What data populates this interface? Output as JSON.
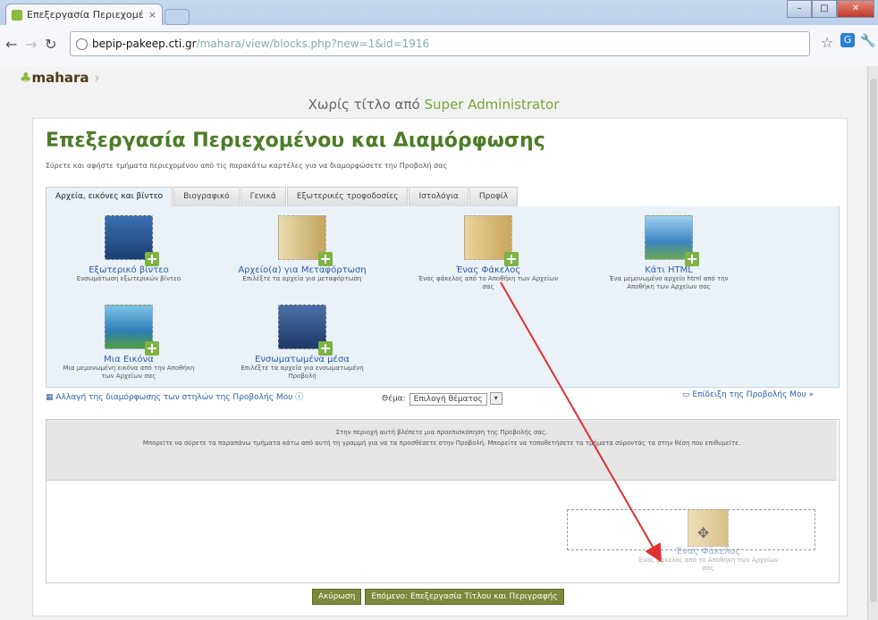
{
  "browser": {
    "tab_title": "Επεξεργασία Περιεχομέν",
    "tab_close": "×",
    "url_host": "bepip-pakeep.cti.gr",
    "url_path": "/mahara/view/blocks.php?new=1&id=1916",
    "window_controls": [
      "–",
      "□",
      "✕"
    ]
  },
  "site": {
    "logo": "mahara",
    "page_title_prefix": "Χωρίς τίτλο από",
    "page_title_user": "Super Administrator"
  },
  "main": {
    "heading": "Επεξεργασία Περιεχομένου και Διαμόρφωσης",
    "description": "Σύρετε και αφήστε τμήματα περιεχομένου από τις παρακάτω καρτέλες για να διαμορφώσετε την Προβολή σας",
    "tabs": [
      {
        "label": "Αρχεία, εικόνες και βίντεο",
        "active": true
      },
      {
        "label": "Βιογραφικό",
        "active": false
      },
      {
        "label": "Γενικά",
        "active": false
      },
      {
        "label": "Εξωτερικές τροφοδοσίες",
        "active": false
      },
      {
        "label": "Ιστολόγια",
        "active": false
      },
      {
        "label": "Προφίλ",
        "active": false
      }
    ],
    "blocks": [
      {
        "icon": "video-icon",
        "title": "Εξωτερικό βίντεο",
        "desc": "Ενσωμάτωση εξωτερικών βίντεο"
      },
      {
        "icon": "files-icon",
        "title": "Αρχείο(α) για Μεταφόρτωση",
        "desc": "Επιλέξτε τα αρχεία για μεταφόρτωση"
      },
      {
        "icon": "folder-icon",
        "title": "Ένας Φάκελος",
        "desc": "Ένας φάκελος από το Αποθήκη των Αρχείων σας"
      },
      {
        "icon": "html-icon",
        "title": "Κάτι HTML",
        "desc": "Ένα μεμονωμένο αρχείο html από την Αποθήκη των Αρχείων σας"
      },
      {
        "icon": "image-icon",
        "title": "Μια Εικόνα",
        "desc": "Μια μεμονωμένη εικόνα από την Αποθήκη των Αρχείων σας"
      },
      {
        "icon": "embedded-media-icon",
        "title": "Ενσωματωμένα μέσα",
        "desc": "Επιλέξτε τα αρχεία για ενσωματωμένη Προβολή"
      }
    ],
    "change_columns_link": "Αλλαγή της διαμόρφωσης των στηλών της Προβολής Μου",
    "theme_label": "Θέμα:",
    "theme_value": "Επιλογή θέματος",
    "preview_link": "Επίδειξη της Προβολής Μου »",
    "notice_line1": "Στην περιοχή αυτή βλέπετε μια προεπισκόπηση της Προβολής σας.",
    "notice_line2": "Μπορείτε να σύρετε τα παραπάνω τμήματα κάτω από αυτή τη γραμμή για να τα προσθέσετε στην Προβολή. Μπορείτε να τοποθετήσετε τα τμήματα σύροντάς τα στην θέση που επιθυμείτε.",
    "drag_ghost": {
      "title": "Ένας Φάκελος",
      "desc": "Ένας φάκελος από το Αποθήκη των Αρχείων σας"
    },
    "buttons": [
      "Ακύρωση",
      "Επόμενο: Επεξεργασία Τίτλου και Περιγραφής"
    ]
  }
}
